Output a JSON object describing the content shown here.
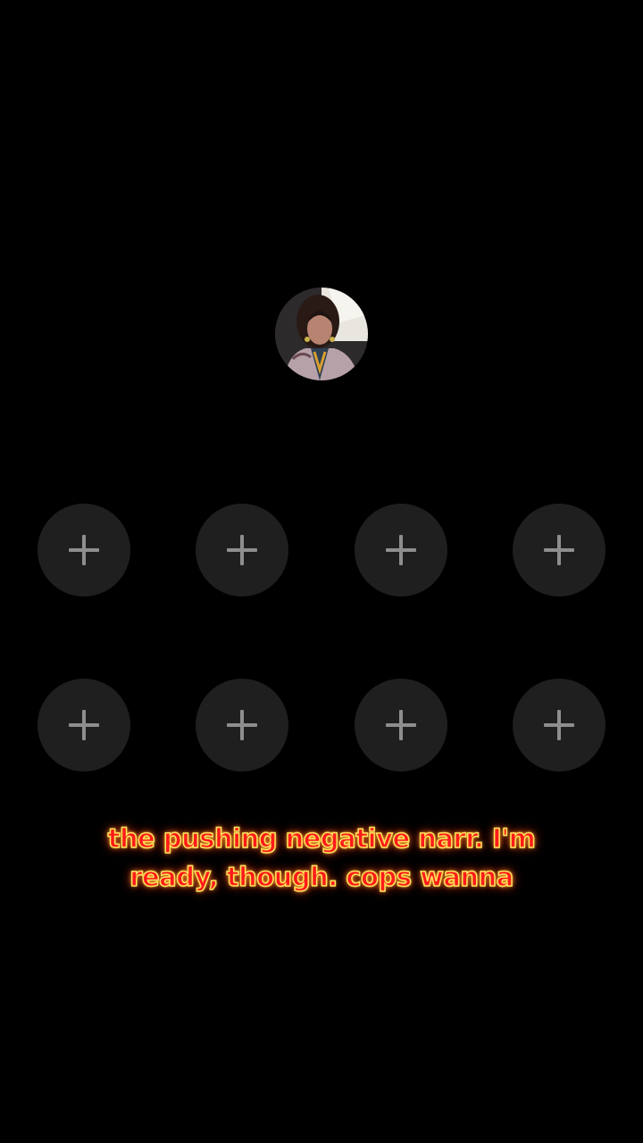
{
  "host": {
    "avatar": "host-avatar-photo"
  },
  "guest_slots": {
    "icon": "plus-icon",
    "rows": [
      [
        "add-guest",
        "add-guest",
        "add-guest",
        "add-guest"
      ],
      [
        "add-guest",
        "add-guest",
        "add-guest",
        "add-guest"
      ]
    ]
  },
  "caption": {
    "line1": "the pushing negative narr. I'm",
    "line2": "ready, though. cops wanna",
    "color": "#ff1a1a",
    "outline_color": "#ffe15a"
  }
}
